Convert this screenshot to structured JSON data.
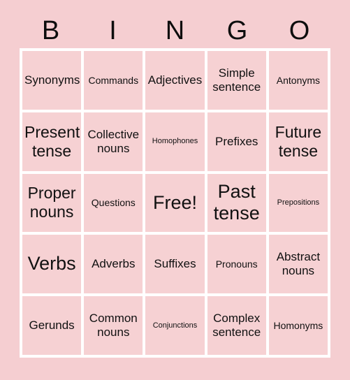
{
  "card": {
    "background_color": "#f5ced1",
    "cell_color": "#f6d1d3",
    "gridline_color": "#ffffff",
    "text_color": "#111111"
  },
  "header": {
    "letters": [
      {
        "label": "B"
      },
      {
        "label": "I"
      },
      {
        "label": "N"
      },
      {
        "label": "G"
      },
      {
        "label": "O"
      }
    ]
  },
  "grid": {
    "rows": 5,
    "columns": 5,
    "cells": [
      {
        "label": "Synonyms",
        "size": "md",
        "free": false
      },
      {
        "label": "Commands",
        "size": "sm",
        "free": false
      },
      {
        "label": "Adjectives",
        "size": "md",
        "free": false
      },
      {
        "label": "Simple sentence",
        "size": "md",
        "free": false
      },
      {
        "label": "Antonyms",
        "size": "sm",
        "free": false
      },
      {
        "label": "Present tense",
        "size": "lg",
        "free": false
      },
      {
        "label": "Collective nouns",
        "size": "md",
        "free": false
      },
      {
        "label": "Homophones",
        "size": "xs",
        "free": false
      },
      {
        "label": "Prefixes",
        "size": "md",
        "free": false
      },
      {
        "label": "Future tense",
        "size": "lg",
        "free": false
      },
      {
        "label": "Proper nouns",
        "size": "lg",
        "free": false
      },
      {
        "label": "Questions",
        "size": "sm",
        "free": false
      },
      {
        "label": "Free!",
        "size": "xl",
        "free": true
      },
      {
        "label": "Past tense",
        "size": "xl",
        "free": false
      },
      {
        "label": "Prepositions",
        "size": "xs",
        "free": false
      },
      {
        "label": "Verbs",
        "size": "xl",
        "free": false
      },
      {
        "label": "Adverbs",
        "size": "md",
        "free": false
      },
      {
        "label": "Suffixes",
        "size": "md",
        "free": false
      },
      {
        "label": "Pronouns",
        "size": "sm",
        "free": false
      },
      {
        "label": "Abstract nouns",
        "size": "md",
        "free": false
      },
      {
        "label": "Gerunds",
        "size": "md",
        "free": false
      },
      {
        "label": "Common nouns",
        "size": "md",
        "free": false
      },
      {
        "label": "Conjunctions",
        "size": "xs",
        "free": false
      },
      {
        "label": "Complex sentence",
        "size": "md",
        "free": false
      },
      {
        "label": "Homonyms",
        "size": "sm",
        "free": false
      }
    ]
  }
}
